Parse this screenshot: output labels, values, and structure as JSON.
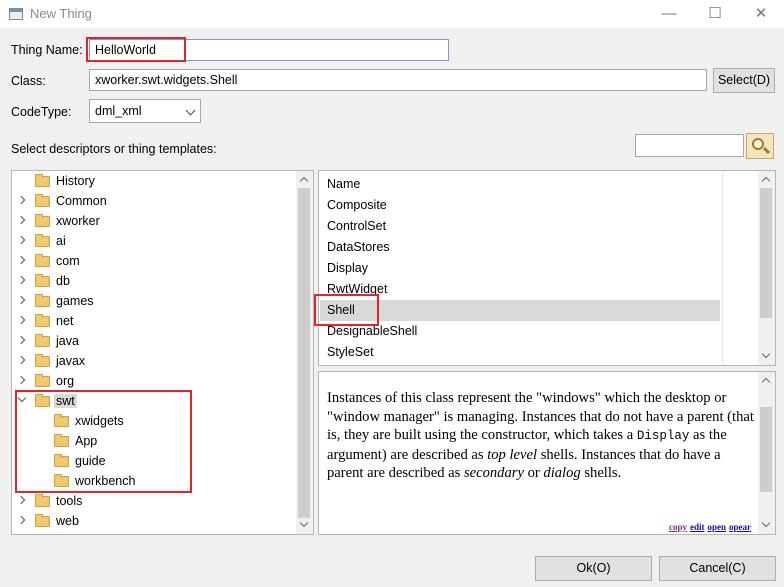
{
  "window": {
    "title": "New Thing",
    "minimize_glyph": "—",
    "maximize_glyph": "☐",
    "close_glyph": "✕"
  },
  "form": {
    "thing_name_label": "Thing Name:",
    "thing_name_value": "HelloWorld",
    "class_label": "Class:",
    "class_value": "xworker.swt.widgets.Shell",
    "select_button": "Select(D)",
    "codetype_label": "CodeType:",
    "codetype_value": "dml_xml",
    "select_descriptors_label": "Select descriptors or thing templates:",
    "search_value": ""
  },
  "tree": {
    "items": [
      {
        "label": "History"
      },
      {
        "label": "Common"
      },
      {
        "label": "xworker"
      },
      {
        "label": "ai"
      },
      {
        "label": "com"
      },
      {
        "label": "db"
      },
      {
        "label": "games"
      },
      {
        "label": "net"
      },
      {
        "label": "java"
      },
      {
        "label": "javax"
      },
      {
        "label": "org"
      },
      {
        "label": "swt"
      },
      {
        "label": "xwidgets"
      },
      {
        "label": "App"
      },
      {
        "label": "guide"
      },
      {
        "label": "workbench"
      },
      {
        "label": "tools"
      },
      {
        "label": "web"
      }
    ]
  },
  "list": {
    "header": "Name",
    "items": [
      {
        "label": "Composite"
      },
      {
        "label": "ControlSet"
      },
      {
        "label": "DataStores"
      },
      {
        "label": "Display"
      },
      {
        "label": "RwtWidget"
      },
      {
        "label": "Shell"
      },
      {
        "label": "DesignableShell"
      },
      {
        "label": "StyleSet"
      }
    ]
  },
  "description": {
    "part1": "Instances of this class represent the \"windows\" which the desktop or \"window manager\" is managing. Instances that do not have a parent (that is, they are built using the constructor, which takes a ",
    "code": "Display",
    "part2": " as the argument) are described as ",
    "em1": "top level",
    "part3": " shells. Instances that do have a parent are described as ",
    "em2": "secondary",
    "part4": " or ",
    "em3": "dialog",
    "part5": " shells.",
    "links": [
      "copy",
      "edit",
      "open",
      "opear"
    ]
  },
  "buttons": {
    "ok": "Ok(O)",
    "cancel": "Cancel(C)"
  }
}
